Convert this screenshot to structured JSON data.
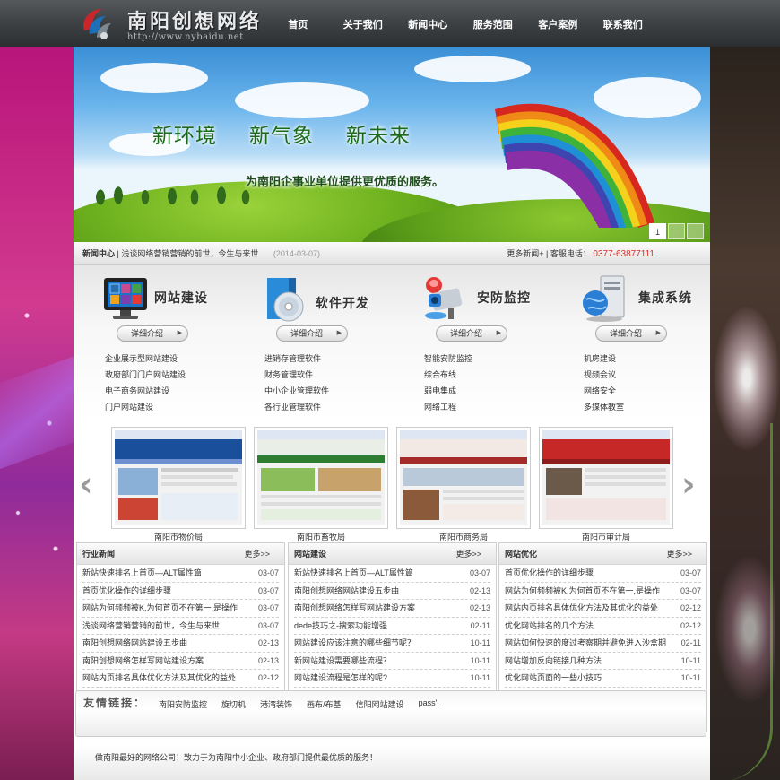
{
  "header": {
    "logo_title": "南阳创想网络",
    "logo_url": "http://www.nybaidu.net",
    "nav": [
      "首页",
      "关于我们",
      "新闻中心",
      "服务范围",
      "客户案例",
      "联系我们"
    ]
  },
  "banner": {
    "headline": [
      "新环境",
      "新气象",
      "新未来"
    ],
    "subline": "为南阳企事业单位提供更优质的服务。",
    "slides": [
      "1",
      "",
      ""
    ]
  },
  "newsbar": {
    "label": "新闻中心",
    "separator": "|",
    "headline": "浅谈网络营销营销的前世，今生与来世",
    "date": "(2014-03-07)",
    "more": "更多新闻+",
    "service_label": "| 客服电话：",
    "phone": "0377-63877111"
  },
  "services": [
    {
      "title": "网站建设",
      "icon": "monitor-icon",
      "button": "详细介绍",
      "links": [
        "企业展示型网站建设",
        "政府部门门户网站建设",
        "电子商务网站建设",
        "门户网站建设"
      ]
    },
    {
      "title": "软件开发",
      "icon": "software-disc-icon",
      "button": "详细介绍",
      "links": [
        "进销存管理软件",
        "财务管理软件",
        "中小企业管理软件",
        "各行业管理软件"
      ]
    },
    {
      "title": "安防监控",
      "icon": "security-camera-icon",
      "button": "详细介绍",
      "links": [
        "智能安防监控",
        "综合布线",
        "弱电集成",
        "网络工程"
      ]
    },
    {
      "title": "集成系统",
      "icon": "server-globe-icon",
      "button": "详细介绍",
      "links": [
        "机房建设",
        "视频会议",
        "网络安全",
        "多媒体教室"
      ]
    }
  ],
  "cases": [
    {
      "name": "南阳市物价局",
      "accent": "#1a4f9c"
    },
    {
      "name": "南阳市畜牧局",
      "accent": "#2e7d32"
    },
    {
      "name": "南阳市商务局",
      "accent": "#a52a2a"
    },
    {
      "name": "南阳市审计局",
      "accent": "#c62828"
    }
  ],
  "columns": [
    {
      "title": "行业新闻",
      "more": "更多>>",
      "items": [
        {
          "t": "新站快速排名上首页—ALT属性篇",
          "d": "03-07"
        },
        {
          "t": "首页优化操作的详细步骤",
          "d": "03-07"
        },
        {
          "t": "网站为何频频被K,为何首页不在第一,是操作",
          "d": "03-07"
        },
        {
          "t": "浅谈网络营销营销的前世，今生与来世",
          "d": "03-07"
        },
        {
          "t": "南阳创想网络网站建设五步曲",
          "d": "02-13"
        },
        {
          "t": "南阳创想网络怎样写网站建设方案",
          "d": "02-13"
        },
        {
          "t": "网站内页排名具体优化方法及其优化的益处",
          "d": "02-12"
        }
      ]
    },
    {
      "title": "网站建设",
      "more": "更多>>",
      "items": [
        {
          "t": "新站快速排名上首页—ALT属性篇",
          "d": "03-07"
        },
        {
          "t": "南阳创想网络网站建设五步曲",
          "d": "02-13"
        },
        {
          "t": "南阳创想网络怎样写网站建设方案",
          "d": "02-13"
        },
        {
          "t": "dede技巧之-搜索功能增强",
          "d": "02-11"
        },
        {
          "t": "网站建设应该注意的哪些细节呢？",
          "d": "10-11"
        },
        {
          "t": "新网站建设需要哪些流程？",
          "d": "10-11"
        },
        {
          "t": "网站建设流程是怎样的呢?",
          "d": "10-11"
        }
      ]
    },
    {
      "title": "网站优化",
      "more": "更多>>",
      "items": [
        {
          "t": "首页优化操作的详细步骤",
          "d": "03-07"
        },
        {
          "t": "网站为何频频被K,为何首页不在第一,是操作",
          "d": "03-07"
        },
        {
          "t": "网站内页排名具体优化方法及其优化的益处",
          "d": "02-12"
        },
        {
          "t": "优化网站排名的几个方法",
          "d": "02-12"
        },
        {
          "t": "网站如何快速的度过考察期并避免进入沙盒期",
          "d": "02-11"
        },
        {
          "t": "网站增加反向链接几种方法",
          "d": "10-11"
        },
        {
          "t": "优化网站页面的一些小技巧",
          "d": "10-11"
        }
      ]
    }
  ],
  "friends": {
    "title": "友情链接：",
    "links": [
      "南阳安防监控",
      "旋切机",
      "港湾装饰",
      "画布/布基",
      "信阳网站建设",
      "pass',"
    ]
  },
  "footer": {
    "text": "做南阳最好的网络公司！致力于为南阳中小企业、政府部门提供最优质的服务！"
  },
  "colors": {
    "header_bg": "#3d4144",
    "phone": "#d8302a",
    "banner_text": "#1a6b1a"
  }
}
